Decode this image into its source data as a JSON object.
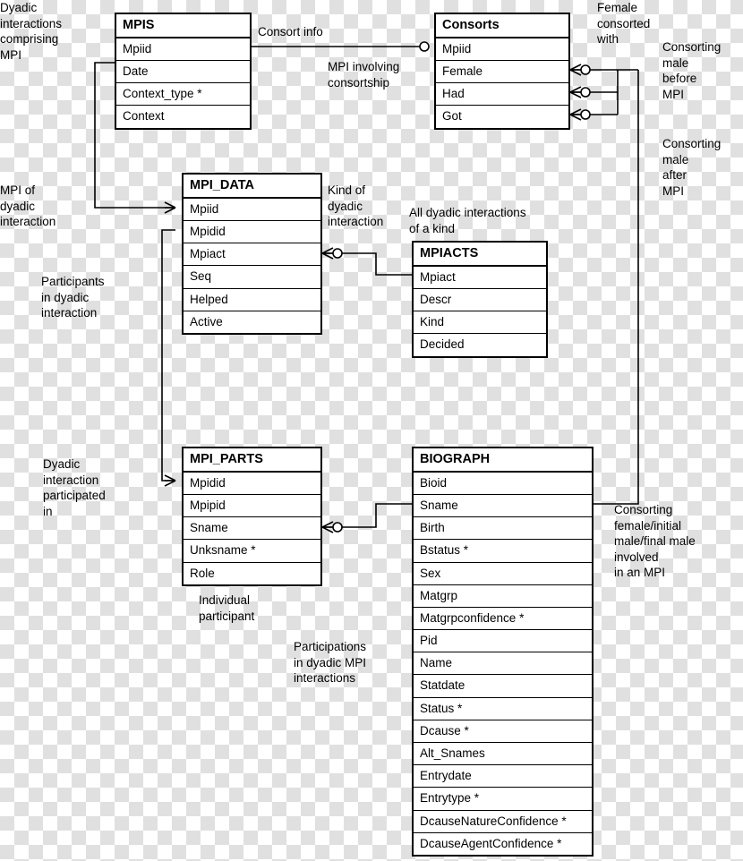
{
  "diagram": {
    "type": "entity-relationship-diagram",
    "entities": [
      {
        "id": "mpis",
        "title": "MPIS",
        "attributes": [
          "Mpiid",
          "Date",
          "Context_type *",
          "Context"
        ]
      },
      {
        "id": "consorts",
        "title": "Consorts",
        "attributes": [
          "Mpiid",
          "Female",
          "Had",
          "Got"
        ]
      },
      {
        "id": "mpi_data",
        "title": "MPI_DATA",
        "attributes": [
          "Mpiid",
          "Mpidid",
          "Mpiact",
          "Seq",
          "Helped",
          "Active"
        ]
      },
      {
        "id": "mpiacts",
        "title": "MPIACTS",
        "attributes": [
          "Mpiact",
          "Descr",
          "Kind",
          "Decided"
        ]
      },
      {
        "id": "mpi_parts",
        "title": "MPI_PARTS",
        "attributes": [
          "Mpidid",
          "Mpipid",
          "Sname",
          "Unksname *",
          "Role"
        ]
      },
      {
        "id": "biograph",
        "title": "BIOGRAPH",
        "attributes": [
          "Bioid",
          "Sname",
          "Birth",
          "Bstatus *",
          "Sex",
          "Matgrp",
          "Matgrpconfidence *",
          "Pid",
          "Name",
          "Statdate",
          "Status *",
          "Dcause *",
          "Alt_Snames",
          "Entrydate",
          "Entrytype *",
          "DcauseNatureConfidence *",
          "DcauseAgentConfidence *"
        ]
      }
    ],
    "notes": [
      {
        "id": "note-dyadic-mpi",
        "text": "Dyadic\ninteractions\ncomprising\nMPI"
      },
      {
        "id": "note-consort-info",
        "text": "Consort info"
      },
      {
        "id": "note-female-consorted",
        "text": "Female\nconsorted\nwith"
      },
      {
        "id": "note-mpi-consortship",
        "text": "MPI involving\nconsortship"
      },
      {
        "id": "note-consorting-before",
        "text": "Consorting\nmale\nbefore\nMPI"
      },
      {
        "id": "note-consorting-after",
        "text": "Consorting\nmale\nafter\nMPI"
      },
      {
        "id": "note-mpi-of-dyadic",
        "text": "MPI of\ndyadic\ninteraction"
      },
      {
        "id": "note-kind-of-dyadic",
        "text": "Kind of\ndyadic\ninteraction"
      },
      {
        "id": "note-all-dyadic",
        "text": "All dyadic interactions\nof a kind"
      },
      {
        "id": "note-participants",
        "text": "Participants\nin dyadic\ninteraction"
      },
      {
        "id": "note-dyadic-participated",
        "text": "Dyadic\ninteraction\nparticipated\nin"
      },
      {
        "id": "note-individual-participant",
        "text": "Individual\nparticipant"
      },
      {
        "id": "note-participations",
        "text": "Participations\nin dyadic MPI\ninteractions"
      },
      {
        "id": "note-consorting-female",
        "text": "Consorting\nfemale/initial\nmale/final male\ninvolved\nin an MPI"
      }
    ]
  }
}
